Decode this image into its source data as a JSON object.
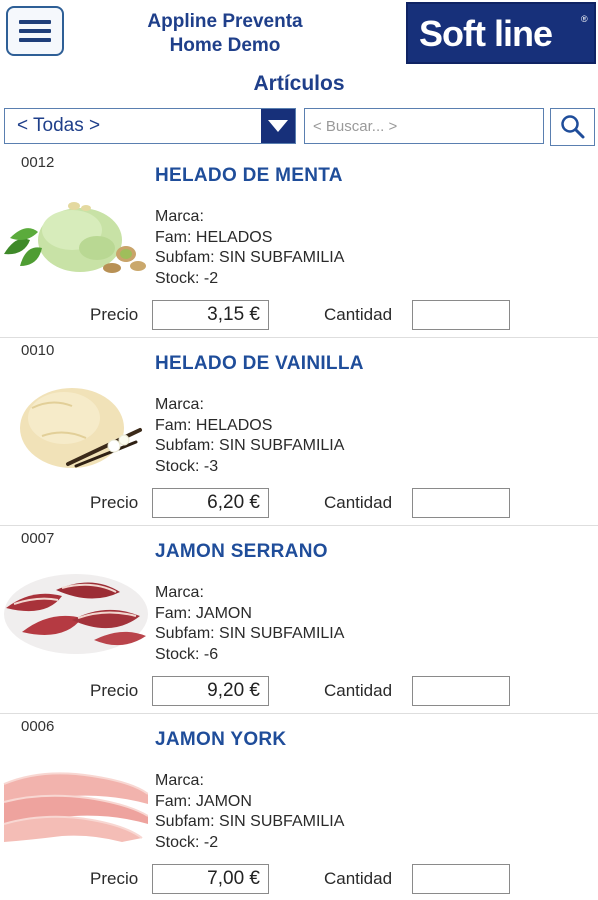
{
  "header": {
    "title_line1": "Appline Preventa",
    "title_line2": "Home Demo",
    "logo_text": "Soft line",
    "brand_color": "#17307a"
  },
  "section_title": "Artículos",
  "filter": {
    "category_value": "< Todas >",
    "search_placeholder": "< Buscar... >"
  },
  "labels": {
    "price": "Precio",
    "quantity": "Cantidad"
  },
  "products": [
    {
      "code": "0012",
      "name": "HELADO DE MENTA",
      "marca": "Marca:",
      "fam": "Fam: HELADOS",
      "subfam": "Subfam: SIN SUBFAMILIA",
      "stock": "Stock: -2",
      "price": "3,15 €",
      "image": "mint-ice-cream"
    },
    {
      "code": "0010",
      "name": "HELADO DE VAINILLA",
      "marca": "Marca:",
      "fam": "Fam: HELADOS",
      "subfam": "Subfam: SIN SUBFAMILIA",
      "stock": "Stock: -3",
      "price": "6,20 €",
      "image": "vanilla-ice-cream"
    },
    {
      "code": "0007",
      "name": "JAMON SERRANO",
      "marca": "Marca:",
      "fam": "Fam: JAMON",
      "subfam": "Subfam: SIN SUBFAMILIA",
      "stock": "Stock: -6",
      "price": "9,20 €",
      "image": "serrano-ham"
    },
    {
      "code": "0006",
      "name": "JAMON YORK",
      "marca": "Marca:",
      "fam": "Fam: JAMON",
      "subfam": "Subfam: SIN SUBFAMILIA",
      "stock": "Stock: -2",
      "price": "7,00 €",
      "image": "york-ham"
    }
  ]
}
